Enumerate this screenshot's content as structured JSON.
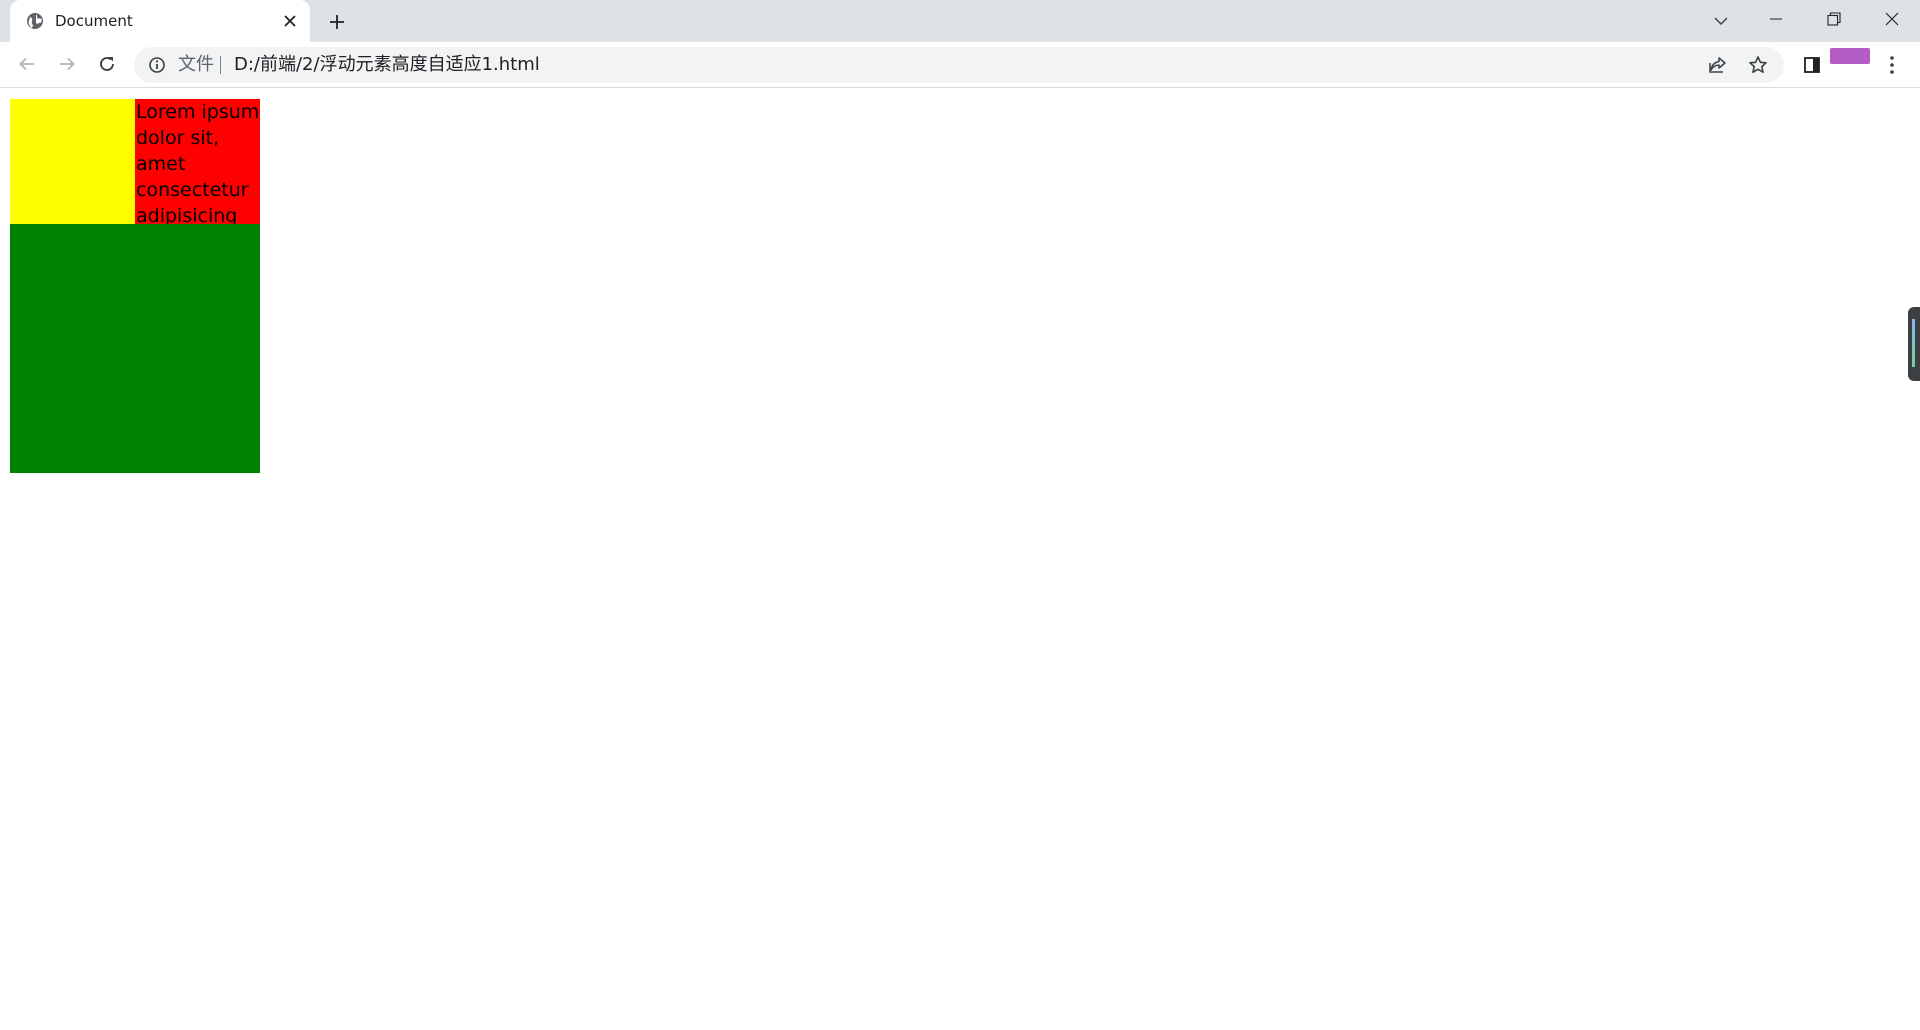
{
  "browser": {
    "tab": {
      "title": "Document",
      "favicon": "globe-icon",
      "close_icon": "close-icon"
    },
    "new_tab_icon": "plus-icon",
    "tab_search_icon": "chevron-down-icon",
    "window_controls": [
      "minimize-icon",
      "restore-icon",
      "close-icon"
    ],
    "toolbar": {
      "back_icon": "arrow-left-icon",
      "forward_icon": "arrow-right-icon",
      "reload_icon": "reload-icon",
      "address": {
        "scheme_label": "文件",
        "url": "D:/前端/2/浮动元素高度自适应1.html",
        "info_icon": "info-icon"
      },
      "share_icon": "share-icon",
      "bookmark_icon": "star-icon",
      "side_panel_icon": "side-panel-icon",
      "profile_color": "#b35cc4",
      "menu_icon": "kebab-menu-icon"
    }
  },
  "page": {
    "yellow_box_color": "#ffff00",
    "red_box": {
      "color": "#ff0000",
      "text": "Lorem ipsum dolor sit, amet consectetur adipisicing"
    },
    "green_box_color": "#008000"
  }
}
